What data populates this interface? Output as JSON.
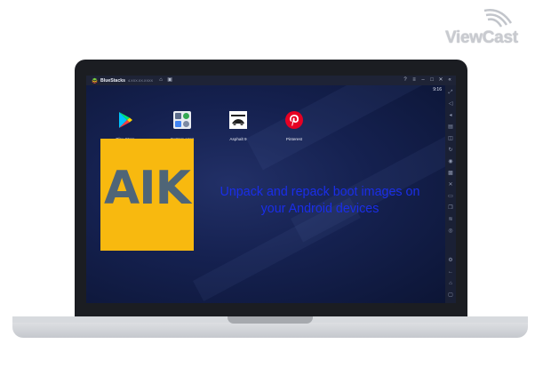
{
  "watermark": {
    "text": "ViewCast"
  },
  "window": {
    "app_name": "BlueStacks",
    "version": "4.XXX.XX.XXXX",
    "clock": "9:16"
  },
  "apps": [
    {
      "label": "Play Store",
      "icon": "play-store-icon"
    },
    {
      "label": "System apps",
      "icon": "system-apps-icon"
    },
    {
      "label": "Asphalt 9",
      "icon": "asphalt-9-icon"
    },
    {
      "label": "Pinterest",
      "icon": "pinterest-icon"
    }
  ],
  "overlay": {
    "logo_text": "AIK",
    "caption": "Unpack and repack boot images on your Android devices"
  },
  "colors": {
    "aik_bg": "#f8b90f",
    "aik_text": "#4f6577",
    "caption": "#1a2ee8"
  }
}
